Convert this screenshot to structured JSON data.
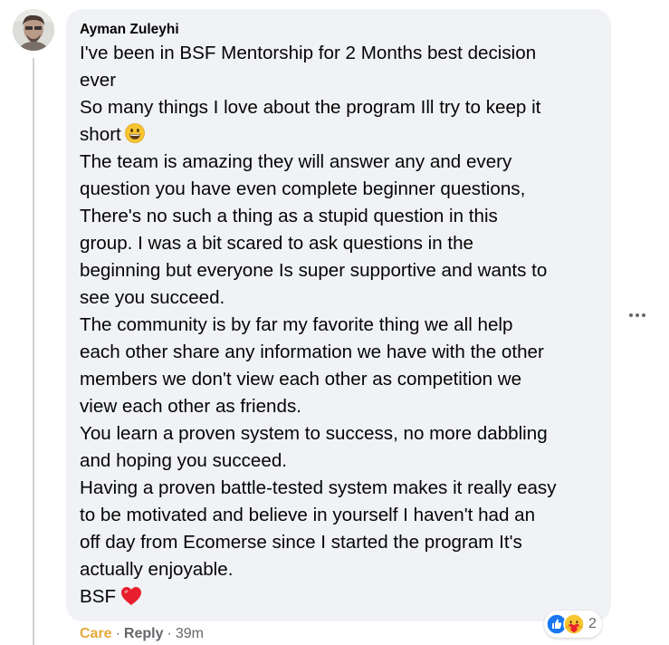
{
  "comment": {
    "author": "Ayman Zuleyhi",
    "lines": [
      "I've been in BSF Mentorship for 2 Months best decision",
      "ever",
      "So many things I love about the program Ill try to keep it",
      "short",
      "The team is amazing they will answer any and every",
      "question you have even complete beginner questions,",
      "There's no such a thing as a stupid question in this",
      "group. I was a bit scared to ask questions in the",
      "beginning but everyone Is super supportive and wants to",
      "see you succeed.",
      "The community is by far my favorite thing we all help",
      "each other share any information we have with the other",
      "members we don't view each other as competition we",
      "view each other as friends.",
      "You learn a proven system to success, no more dabbling",
      "and hoping you succeed.",
      "Having a proven battle-tested system makes it really easy",
      "to be motivated and believe in yourself I haven't had an",
      "off day from Ecomerse since I started the program It's",
      "actually enjoyable.",
      "BSF"
    ],
    "emojis": {
      "line_4": "grinning-face-emoji",
      "line_21": "red-heart-emoji"
    }
  },
  "actions": {
    "care_label": "Care",
    "separator": "·",
    "reply_label": "Reply",
    "time": "39m"
  },
  "reactions": {
    "icons": [
      "like-icon",
      "care-icon"
    ],
    "count": "2"
  },
  "colors": {
    "bubble_bg": "#f0f2f5",
    "care_active": "#e5a93c",
    "meta_text": "#65676b",
    "like_blue": "#1877f2"
  }
}
